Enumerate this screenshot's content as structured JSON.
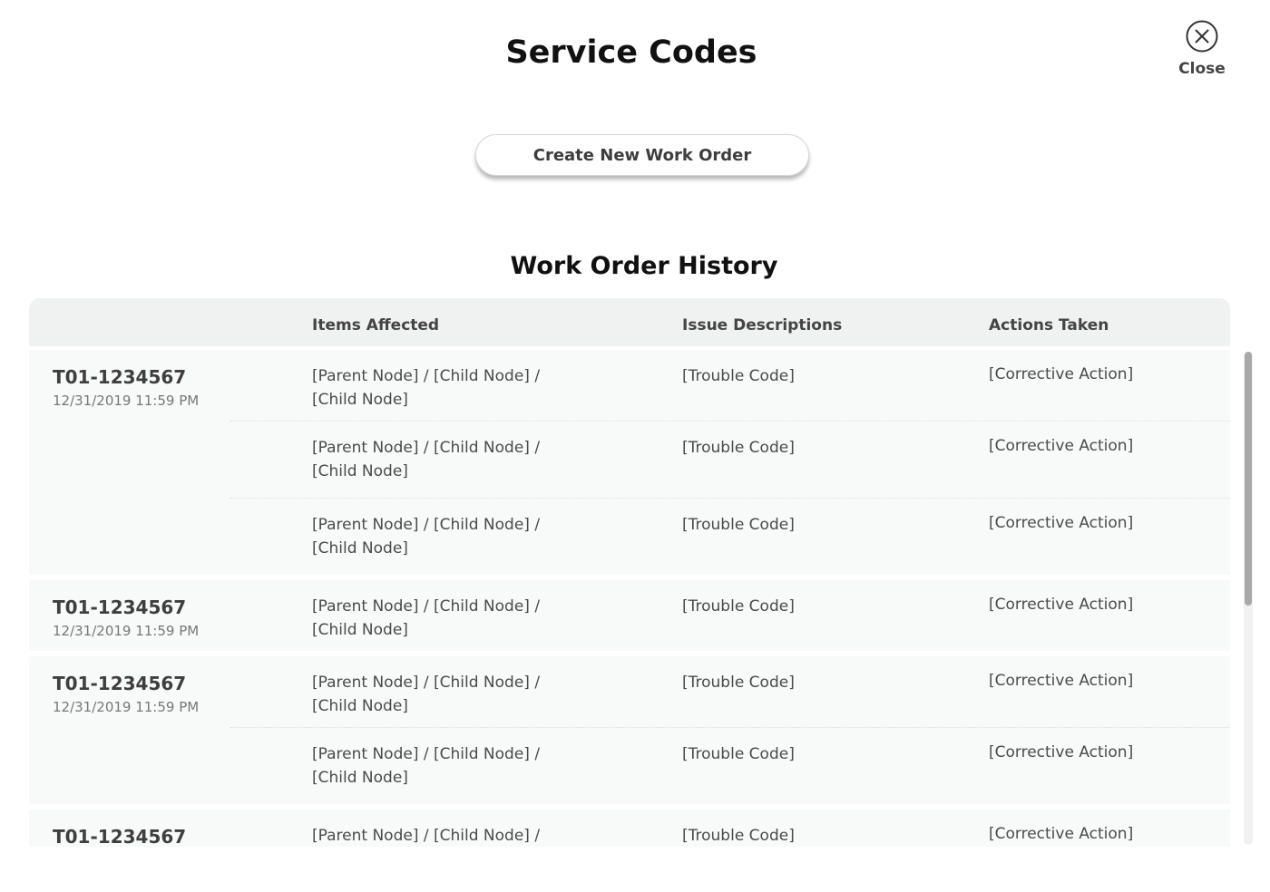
{
  "header": {
    "title": "Service Codes",
    "close_label": "Close"
  },
  "actions": {
    "create_label": "Create New Work Order"
  },
  "history": {
    "title": "Work Order History",
    "columns": [
      "",
      "Items Affected",
      "Issue Descriptions",
      "Actions Taken"
    ],
    "orders": [
      {
        "id": "T01-1234567",
        "date": "12/31/2019 11:59 PM",
        "items": [
          {
            "affected": "[Parent Node] / [Child Node] / [Child Node]",
            "issue": "[Trouble Code]",
            "action": "[Corrective Action]"
          },
          {
            "affected": "[Parent Node] / [Child Node] / [Child Node]",
            "issue": "[Trouble Code]",
            "action": "[Corrective Action]"
          },
          {
            "affected": "[Parent Node] / [Child Node] / [Child Node]",
            "issue": "[Trouble Code]",
            "action": "[Corrective Action]"
          }
        ]
      },
      {
        "id": "T01-1234567",
        "date": "12/31/2019 11:59 PM",
        "items": [
          {
            "affected": "[Parent Node] / [Child Node] / [Child Node]",
            "issue": "[Trouble Code]",
            "action": "[Corrective Action]"
          }
        ]
      },
      {
        "id": "T01-1234567",
        "date": "12/31/2019 11:59 PM",
        "items": [
          {
            "affected": "[Parent Node] / [Child Node] / [Child Node]",
            "issue": "[Trouble Code]",
            "action": "[Corrective Action]"
          },
          {
            "affected": "[Parent Node] / [Child Node] / [Child Node]",
            "issue": "[Trouble Code]",
            "action": "[Corrective Action]"
          }
        ]
      },
      {
        "id": "T01-1234567",
        "date": "",
        "items": [
          {
            "affected": "[Parent Node] / [Child Node] /",
            "issue": "[Trouble Code]",
            "action": "[Corrective Action]"
          }
        ]
      }
    ]
  },
  "icons": {
    "close": "close-circle-icon"
  },
  "colors": {
    "background": "#ffffff",
    "header_row": "#f0f1f1",
    "row_background": "#f8f9f9",
    "scroll_thumb": "#a9a9a9"
  }
}
